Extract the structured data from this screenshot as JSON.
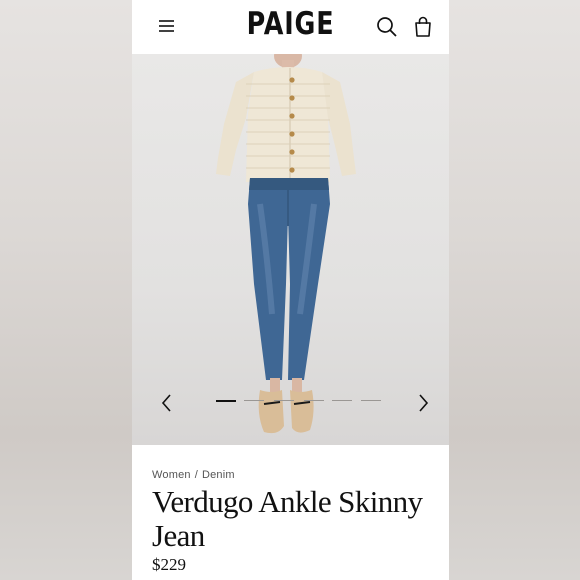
{
  "header": {
    "brand": "PAIGE",
    "menu_icon": "hamburger-menu-icon",
    "search_icon": "search-icon",
    "bag_icon": "shopping-bag-icon"
  },
  "gallery": {
    "prev_icon": "chevron-left-icon",
    "next_icon": "chevron-right-icon",
    "slide_count": 6,
    "active_slide": 1
  },
  "product": {
    "breadcrumb": [
      "Women",
      "Denim"
    ],
    "breadcrumb_separator": "/",
    "title": "Verdugo Ankle Skinny Jean",
    "price": "$229"
  }
}
